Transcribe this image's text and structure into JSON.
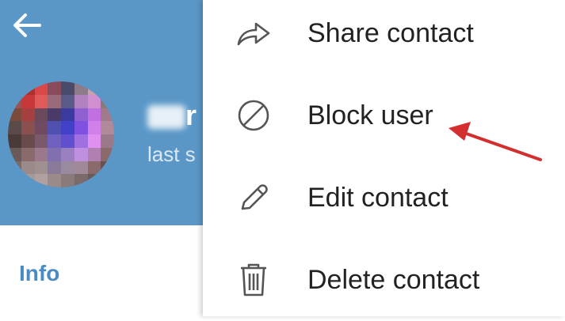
{
  "profile": {
    "name_visible_char": "r",
    "status_partial": "last s"
  },
  "info": {
    "label": "Info"
  },
  "menu": {
    "items": [
      {
        "id": "share",
        "label": "Share contact",
        "icon": "share-icon"
      },
      {
        "id": "block",
        "label": "Block user",
        "icon": "block-icon"
      },
      {
        "id": "edit",
        "label": "Edit contact",
        "icon": "pencil-icon"
      },
      {
        "id": "delete",
        "label": "Delete contact",
        "icon": "trash-icon"
      }
    ]
  },
  "colors": {
    "header": "#5a97c7",
    "accent": "#4a8bc2",
    "annotation_arrow": "#d32f2f",
    "icon": "#555555"
  }
}
